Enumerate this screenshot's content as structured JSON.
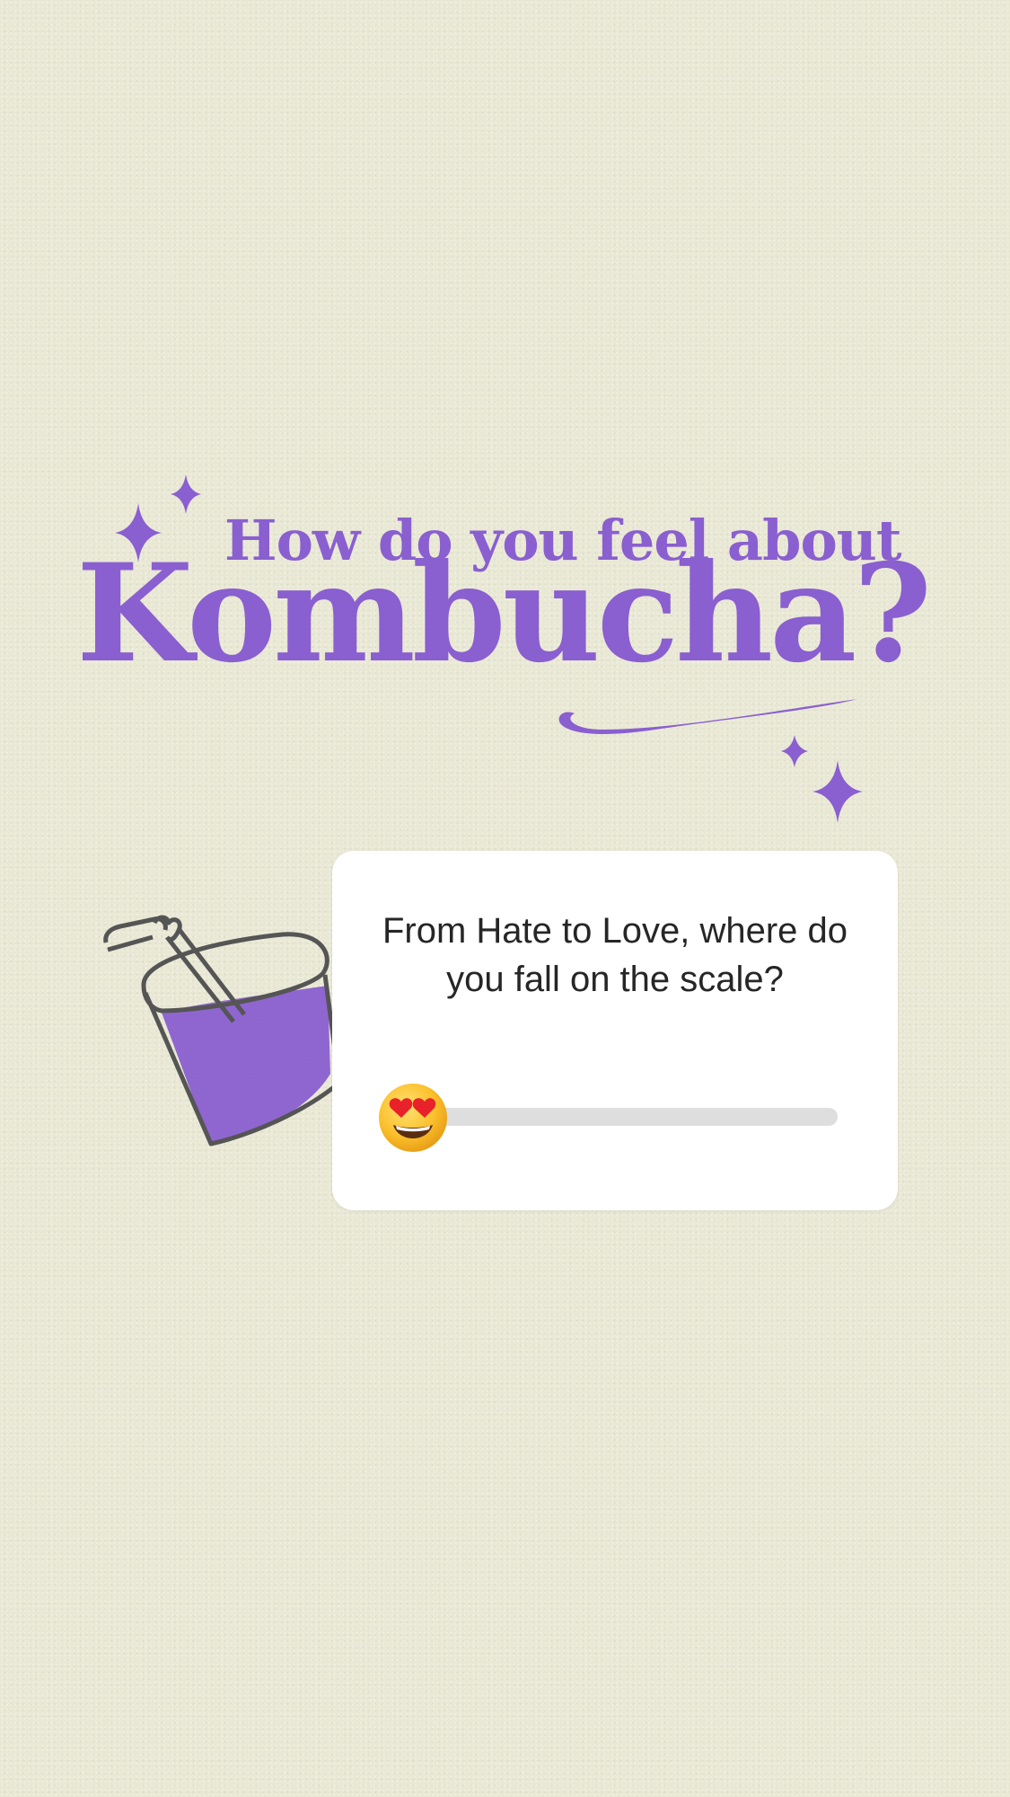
{
  "heading": {
    "line1": "How do you feel about",
    "line2": "Kombucha?"
  },
  "slider": {
    "question": "From Hate to Love, where do you fall on the scale?",
    "emoji": "heart-eyes-emoji",
    "value_fraction": 0.0
  },
  "colors": {
    "accent": "#8a5fd0",
    "background": "#e9e8d5",
    "card": "#ffffff",
    "track": "#dedede",
    "text": "#262626"
  }
}
